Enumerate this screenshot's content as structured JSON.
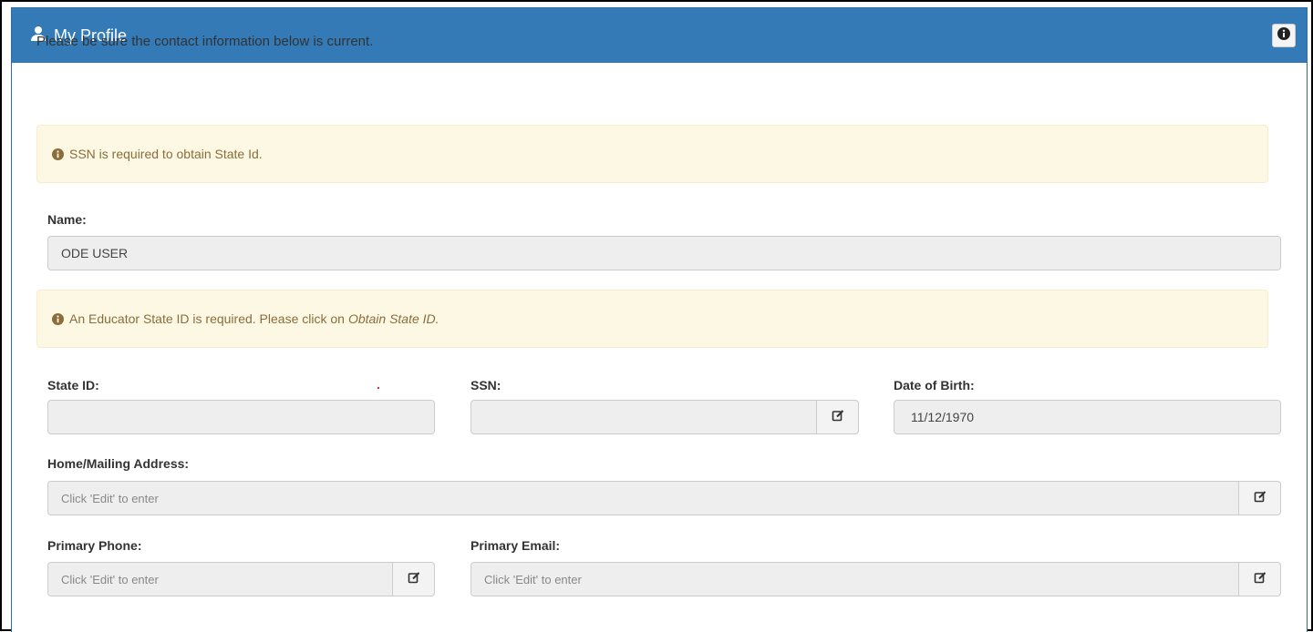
{
  "header": {
    "title": "My Profile",
    "user_icon": "user-icon",
    "info_icon": "info-circle-icon",
    "background": "#337ab7"
  },
  "intro_text": "Please be sure the contact information below is current.",
  "alerts": {
    "ssn": {
      "text": "SSN is required to obtain State Id.",
      "icon": "info-circle-icon"
    },
    "state_id": {
      "text": "An Educator State ID is required. Please click on",
      "emphasis": "Obtain State ID.",
      "icon": "info-circle-icon"
    }
  },
  "fields": {
    "name": {
      "label": "Name:",
      "value": "ODE USER"
    },
    "state_id": {
      "label": "State ID:",
      "value": ""
    },
    "ssn": {
      "label": "SSN:",
      "value": "",
      "edit_icon": "edit-icon"
    },
    "dob": {
      "label": "Date of Birth:",
      "value": "11/12/1970"
    },
    "address": {
      "label": "Home/Mailing Address:",
      "placeholder": "Click 'Edit' to enter",
      "edit_icon": "edit-icon"
    },
    "phone": {
      "label": "Primary Phone:",
      "placeholder": "Click 'Edit' to enter",
      "edit_icon": "edit-icon"
    },
    "email": {
      "label": "Primary Email:",
      "placeholder": "Click 'Edit' to enter",
      "edit_icon": "edit-icon"
    }
  },
  "colors": {
    "alert_bg": "#fcf8e3",
    "alert_text": "#8a6d3b",
    "field_bg": "#eeeeee"
  }
}
